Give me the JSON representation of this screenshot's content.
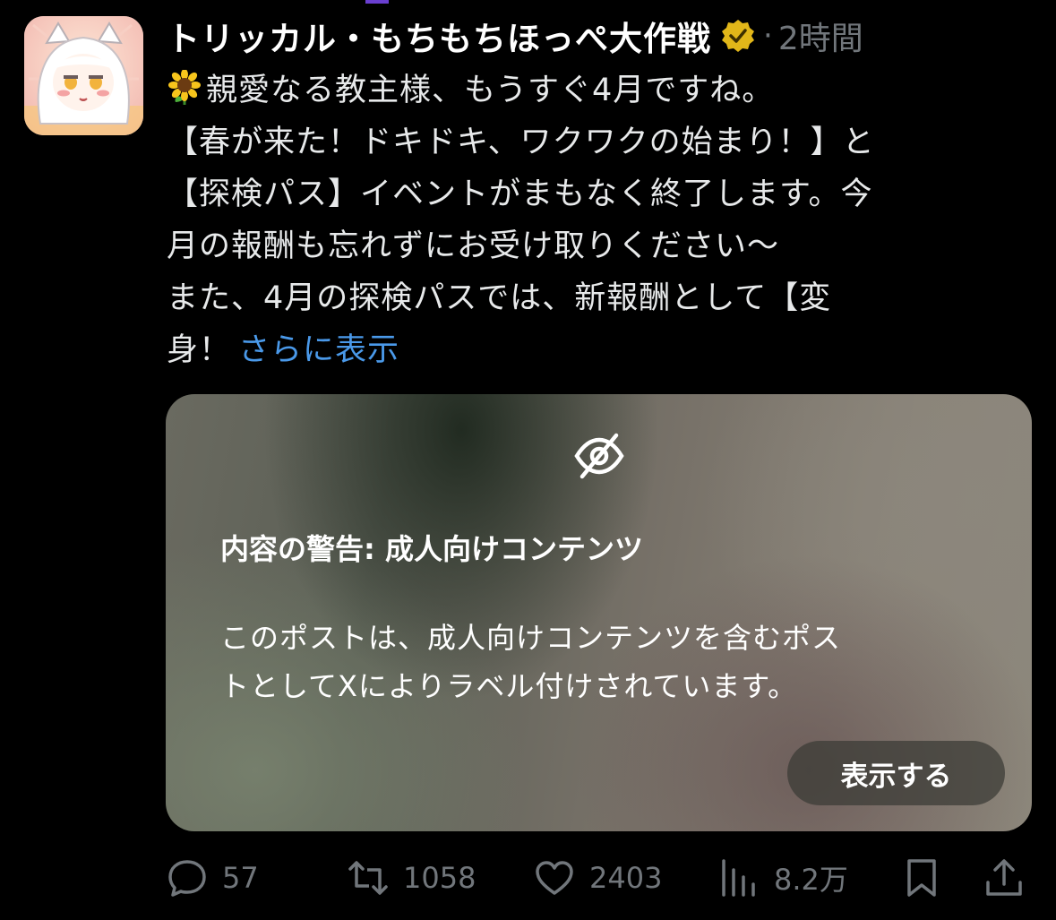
{
  "post": {
    "author_name": "トリッカル・もちもちほっぺ大作戦",
    "separator": "·",
    "time": "2時間",
    "text_lines": [
      "親愛なる教主様、もうすぐ4月ですね。",
      "【春が来た！ドキドキ、ワクワクの始まり！】と",
      "【探検パス】イベントがまもなく終了します。今",
      "月の報酬も忘れずにお受け取りください〜",
      "また、4月の探検パスでは、新報酬として【変",
      "身！"
    ],
    "show_more": "さらに表示"
  },
  "media_warning": {
    "title": "内容の警告: 成人向けコンテンツ",
    "description_lines": [
      "このポストは、成人向けコンテンツを含むポス",
      "トとしてXによりラベル付けされています。"
    ],
    "show_button": "表示する"
  },
  "actions": {
    "replies": "57",
    "reposts": "1058",
    "likes": "2403",
    "views": "8.2万"
  },
  "icons": {
    "verified": "verified-badge-icon",
    "emoji": "sunflower-emoji-icon",
    "warning": "eye-off-icon",
    "reply": "reply-icon",
    "repost": "repost-icon",
    "like": "heart-icon",
    "views": "views-icon",
    "bookmark": "bookmark-icon",
    "share": "share-icon"
  },
  "colors": {
    "background": "#000000",
    "text": "#e7e9ea",
    "muted": "#71767b",
    "link": "#4a99e9",
    "verified_gold": "#e2b719"
  }
}
